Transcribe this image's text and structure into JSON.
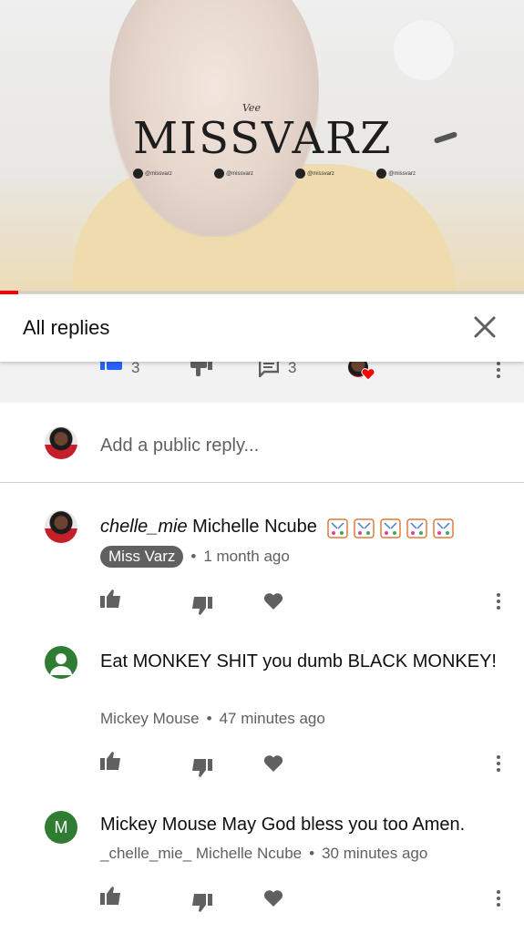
{
  "video": {
    "tagline": "Vee",
    "brand": "MISSVARZ",
    "socials": [
      {
        "icon": "facebook-icon",
        "handle": "@missvarz"
      },
      {
        "icon": "snapchat-icon",
        "handle": "@missvarz"
      },
      {
        "icon": "instagram-icon",
        "handle": "@missvarz"
      },
      {
        "icon": "twitter-icon",
        "handle": "@missvarz"
      }
    ],
    "progress_fraction": 0.034
  },
  "header": {
    "title": "All replies",
    "close_icon": "close-icon"
  },
  "parent": {
    "likes": "3",
    "replies": "3"
  },
  "reply_box": {
    "placeholder": "Add a public reply..."
  },
  "comments": [
    {
      "author_prefix": "chelle_mie",
      "text": "Michelle Ncube",
      "emoji": "party-popper-emoji",
      "badge": "Miss Varz",
      "time": "1 month ago"
    },
    {
      "text": "Eat MONKEY SHIT you dumb BLACK MONKEY!",
      "author": "Mickey Mouse",
      "time": "47 minutes ago"
    },
    {
      "avatar_letter": "M",
      "text": "Mickey Mouse May God bless you too Amen.",
      "author": "_chelle_mie_ Michelle Ncube",
      "time": "30 minutes ago"
    }
  ],
  "colors": {
    "accent_red": "#ff0000",
    "icon_gray": "#606060",
    "avatar_green": "#2e7d32"
  }
}
